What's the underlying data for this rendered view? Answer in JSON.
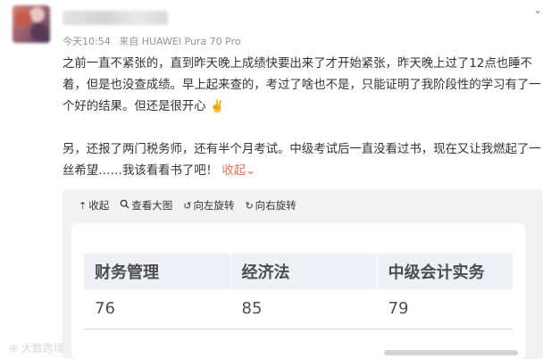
{
  "post": {
    "time": "今天10:54",
    "source": "来自 HUAWEI Pura 70 Pro",
    "paragraph1": "之前一直不紧张的，直到昨天晚上成绩快要出来了才开始紧张，昨天晚上过了12点也睡不着，但是也没查成绩。早上起来查的，考过了啥也不是，只能证明了我阶段性的学习有了一个好的结果。但还是很开心",
    "victory_emoji": "✌️",
    "paragraph2": "另，还报了两门税务师，还有半个月考试。中级考试后一直没看过书，现在又让我燃起了一丝希望……我该看看书了吧！",
    "collapse_link": "收起",
    "collapse_chevron": "⌄"
  },
  "toolbar": {
    "collapse": "收起",
    "view_large": "查看大图",
    "rotate_left": "向左旋转",
    "rotate_right": "向右旋转"
  },
  "scores_table": {
    "headers": [
      "财务管理",
      "经济法",
      "中级会计实务"
    ],
    "values": [
      "76",
      "85",
      "79"
    ]
  },
  "watermark": "大数跨境",
  "icons": {
    "menu": "chevron-down-icon",
    "collapse": "up-arrow-icon",
    "view_large": "magnifier-icon",
    "rotate_left": "rotate-left-icon",
    "rotate_right": "rotate-right-icon"
  },
  "colors": {
    "link": "#eb7350",
    "meta": "#939393",
    "panel": "#f2f2f2",
    "table_header": "#eef0f5"
  }
}
